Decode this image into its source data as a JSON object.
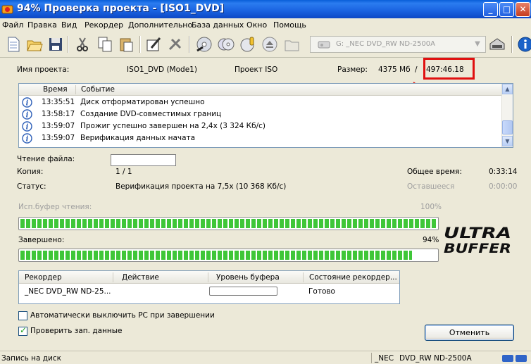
{
  "window": {
    "title": "94% Проверка проекта - [ISO1_DVD]"
  },
  "menu": [
    "Файл",
    "Правка",
    "Вид",
    "Рекордер",
    "Дополнительно",
    "База данных",
    "Окно",
    "Помощь"
  ],
  "toolbar": {
    "drive_label": "G: _NEC DVD_RW ND-2500A"
  },
  "project": {
    "name_label": "Имя проекта:",
    "name_value": "ISO1_DVD (Mode1)",
    "type_value": "Проект ISO",
    "size_label": "Размер:",
    "size_value": "4375 Мб",
    "size_sep": "/",
    "time_value": "497:46.18"
  },
  "log": {
    "col_time": "Время",
    "col_event": "Событие",
    "rows": [
      {
        "time": "13:35:51",
        "event": "Диск отформатирован успешно"
      },
      {
        "time": "13:58:17",
        "event": "Создание DVD-совместимых границ"
      },
      {
        "time": "13:59:07",
        "event": "Прожиг успешно завершен на 2,4x (3 324 Кб/с)"
      },
      {
        "time": "13:59:07",
        "event": "Верификация данных начата"
      }
    ]
  },
  "stats": {
    "read_label": "Чтение файла:",
    "copy_label": "Копия:",
    "copy_value": "1 / 1",
    "total_time_label": "Общее время:",
    "total_time_value": "0:33:14",
    "status_label": "Статус:",
    "status_value": "Верификация проекта на 7,5x (10 368 Кб/с)",
    "remaining_label": "Оставшееся",
    "remaining_value": "0:00:00"
  },
  "buffer": {
    "label": "Исп.буфер чтения:",
    "percent_text": "100%",
    "fraction": 1.0
  },
  "done": {
    "label": "Завершено:",
    "percent_text": "94%",
    "fraction": 0.94
  },
  "logo": {
    "line1": "ULTRA",
    "line2": "BUFFER"
  },
  "recorders": {
    "col_recorder": "Рекордер",
    "col_action": "Действие",
    "col_buffer": "Уровень буфера",
    "col_state": "Состояние рекордер...",
    "rows": [
      {
        "recorder": "_NEC DVD_RW ND-25...",
        "action": "",
        "buffer_fraction": 0,
        "state": "Готово"
      }
    ]
  },
  "options": {
    "shutdown_label": "Автоматически выключить PC при завершении",
    "shutdown_checked": false,
    "verify_label": "Проверить зап. данные",
    "verify_checked": true
  },
  "cancel_label": "Отменить",
  "statusbar": {
    "left": "Запись на диск",
    "middle": "_NEC",
    "right": "DVD_RW ND-2500A"
  },
  "colors": {
    "accent_red": "#e01010",
    "progress_green": "#3fc638",
    "title_blue": "#0a5fd8"
  }
}
